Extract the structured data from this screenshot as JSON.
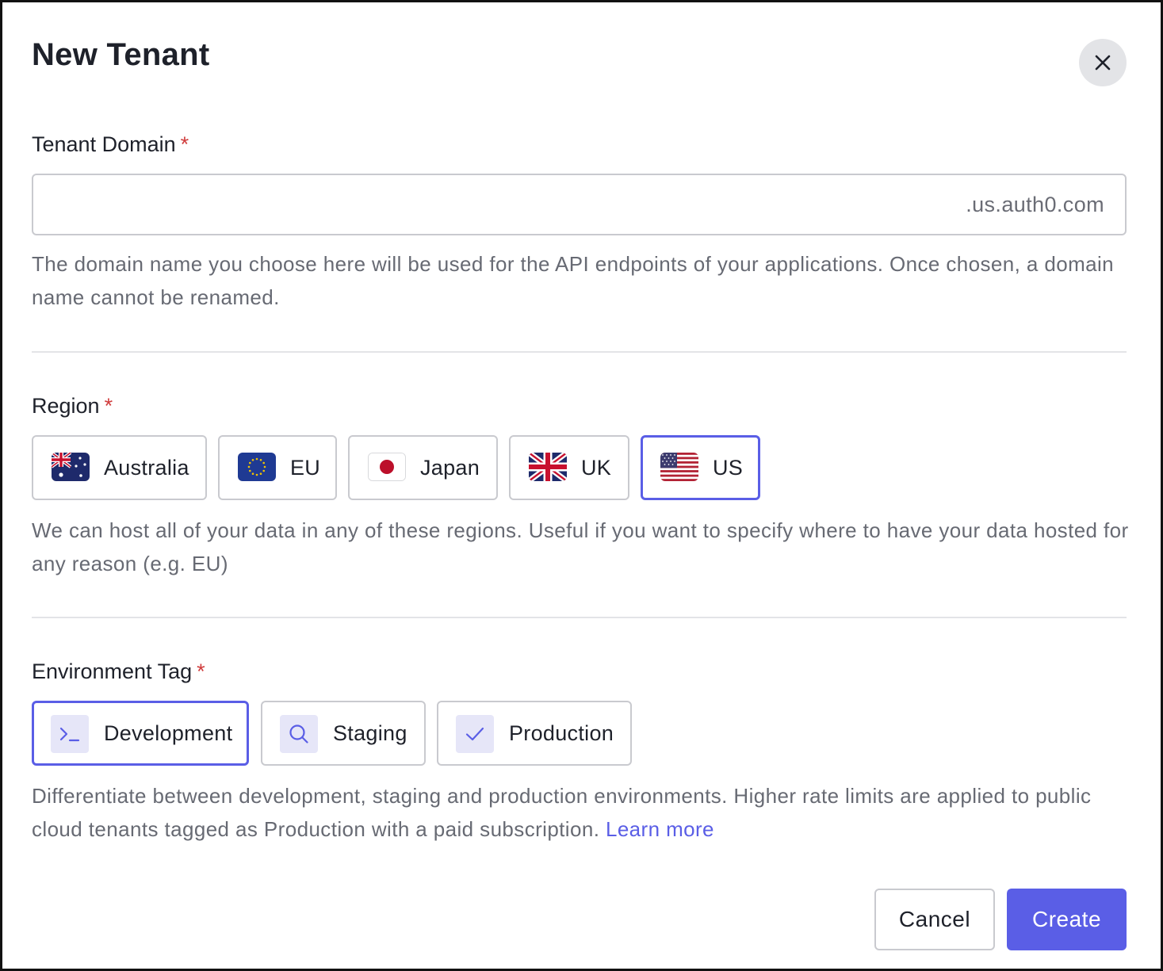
{
  "dialog": {
    "title": "New Tenant",
    "close_icon": "close-icon"
  },
  "domain": {
    "label": "Tenant Domain",
    "required_mark": "*",
    "value": "",
    "suffix": ".us.auth0.com",
    "help": "The domain name you choose here will be used for the API endpoints of your applications. Once chosen, a domain name cannot be renamed."
  },
  "region": {
    "label": "Region",
    "required_mark": "*",
    "selected": "US",
    "options": [
      {
        "label": "Australia",
        "icon": "australia-flag-icon"
      },
      {
        "label": "EU",
        "icon": "eu-flag-icon"
      },
      {
        "label": "Japan",
        "icon": "japan-flag-icon"
      },
      {
        "label": "UK",
        "icon": "uk-flag-icon"
      },
      {
        "label": "US",
        "icon": "us-flag-icon"
      }
    ],
    "help": "We can host all of your data in any of these regions. Useful if you want to specify where to have your data hosted for any reason (e.g. EU)"
  },
  "environment": {
    "label": "Environment Tag",
    "required_mark": "*",
    "selected": "Development",
    "options": [
      {
        "label": "Development",
        "icon": "terminal-icon"
      },
      {
        "label": "Staging",
        "icon": "search-icon"
      },
      {
        "label": "Production",
        "icon": "check-icon"
      }
    ],
    "help": "Differentiate between development, staging and production environments. Higher rate limits are applied to public cloud tenants tagged as Production with a paid subscription.",
    "link": "Learn more"
  },
  "actions": {
    "cancel": "Cancel",
    "create": "Create"
  },
  "colors": {
    "accent": "#5a5ee6",
    "required": "#d03c3c",
    "border": "#c9cacf",
    "muted_text": "#676a73"
  }
}
